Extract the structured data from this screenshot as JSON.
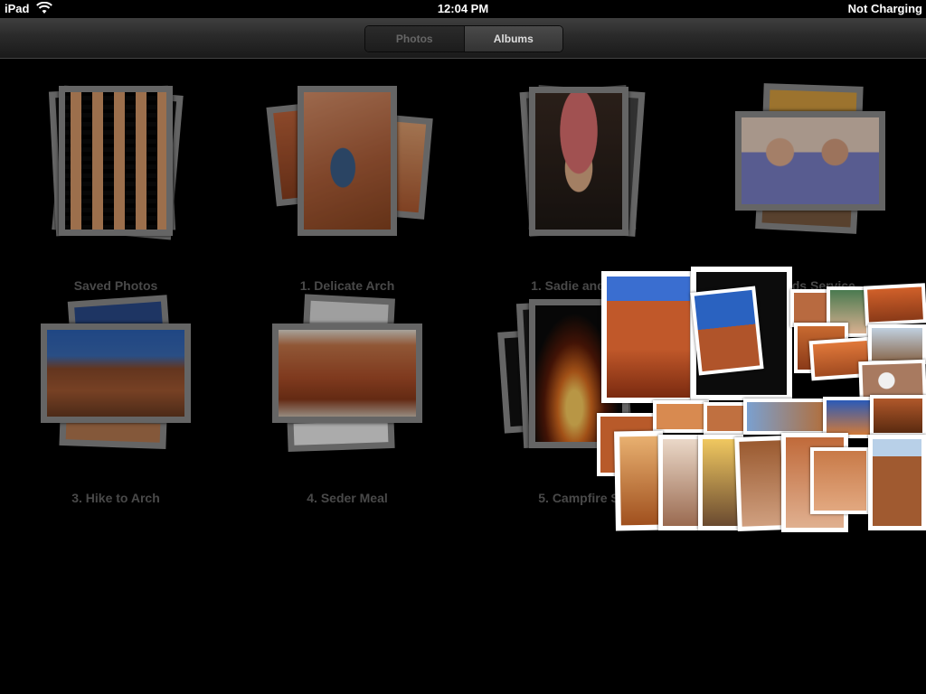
{
  "status_bar": {
    "device": "iPad",
    "wifi_icon": "wifi-icon",
    "time": "12:04 PM",
    "battery": "Not Charging"
  },
  "nav": {
    "segments": [
      {
        "label": "Photos",
        "selected": false
      },
      {
        "label": "Albums",
        "selected": true
      }
    ]
  },
  "albums": [
    {
      "title": "Saved Photos"
    },
    {
      "title": "1. Delicate Arch"
    },
    {
      "title": "1. Sadie and Ori"
    },
    {
      "title": "2. Kids Service"
    },
    {
      "title": "3. Hike to Arch"
    },
    {
      "title": "4. Seder Meal"
    },
    {
      "title": "5. Campfire S"
    }
  ],
  "colors": {
    "background": "#000000",
    "album_title": "#666666",
    "segment_active_text": "#dddddd",
    "segment_inactive_text": "#666666",
    "red_rock": "#b5532a",
    "sky": "#2a5aa8"
  }
}
